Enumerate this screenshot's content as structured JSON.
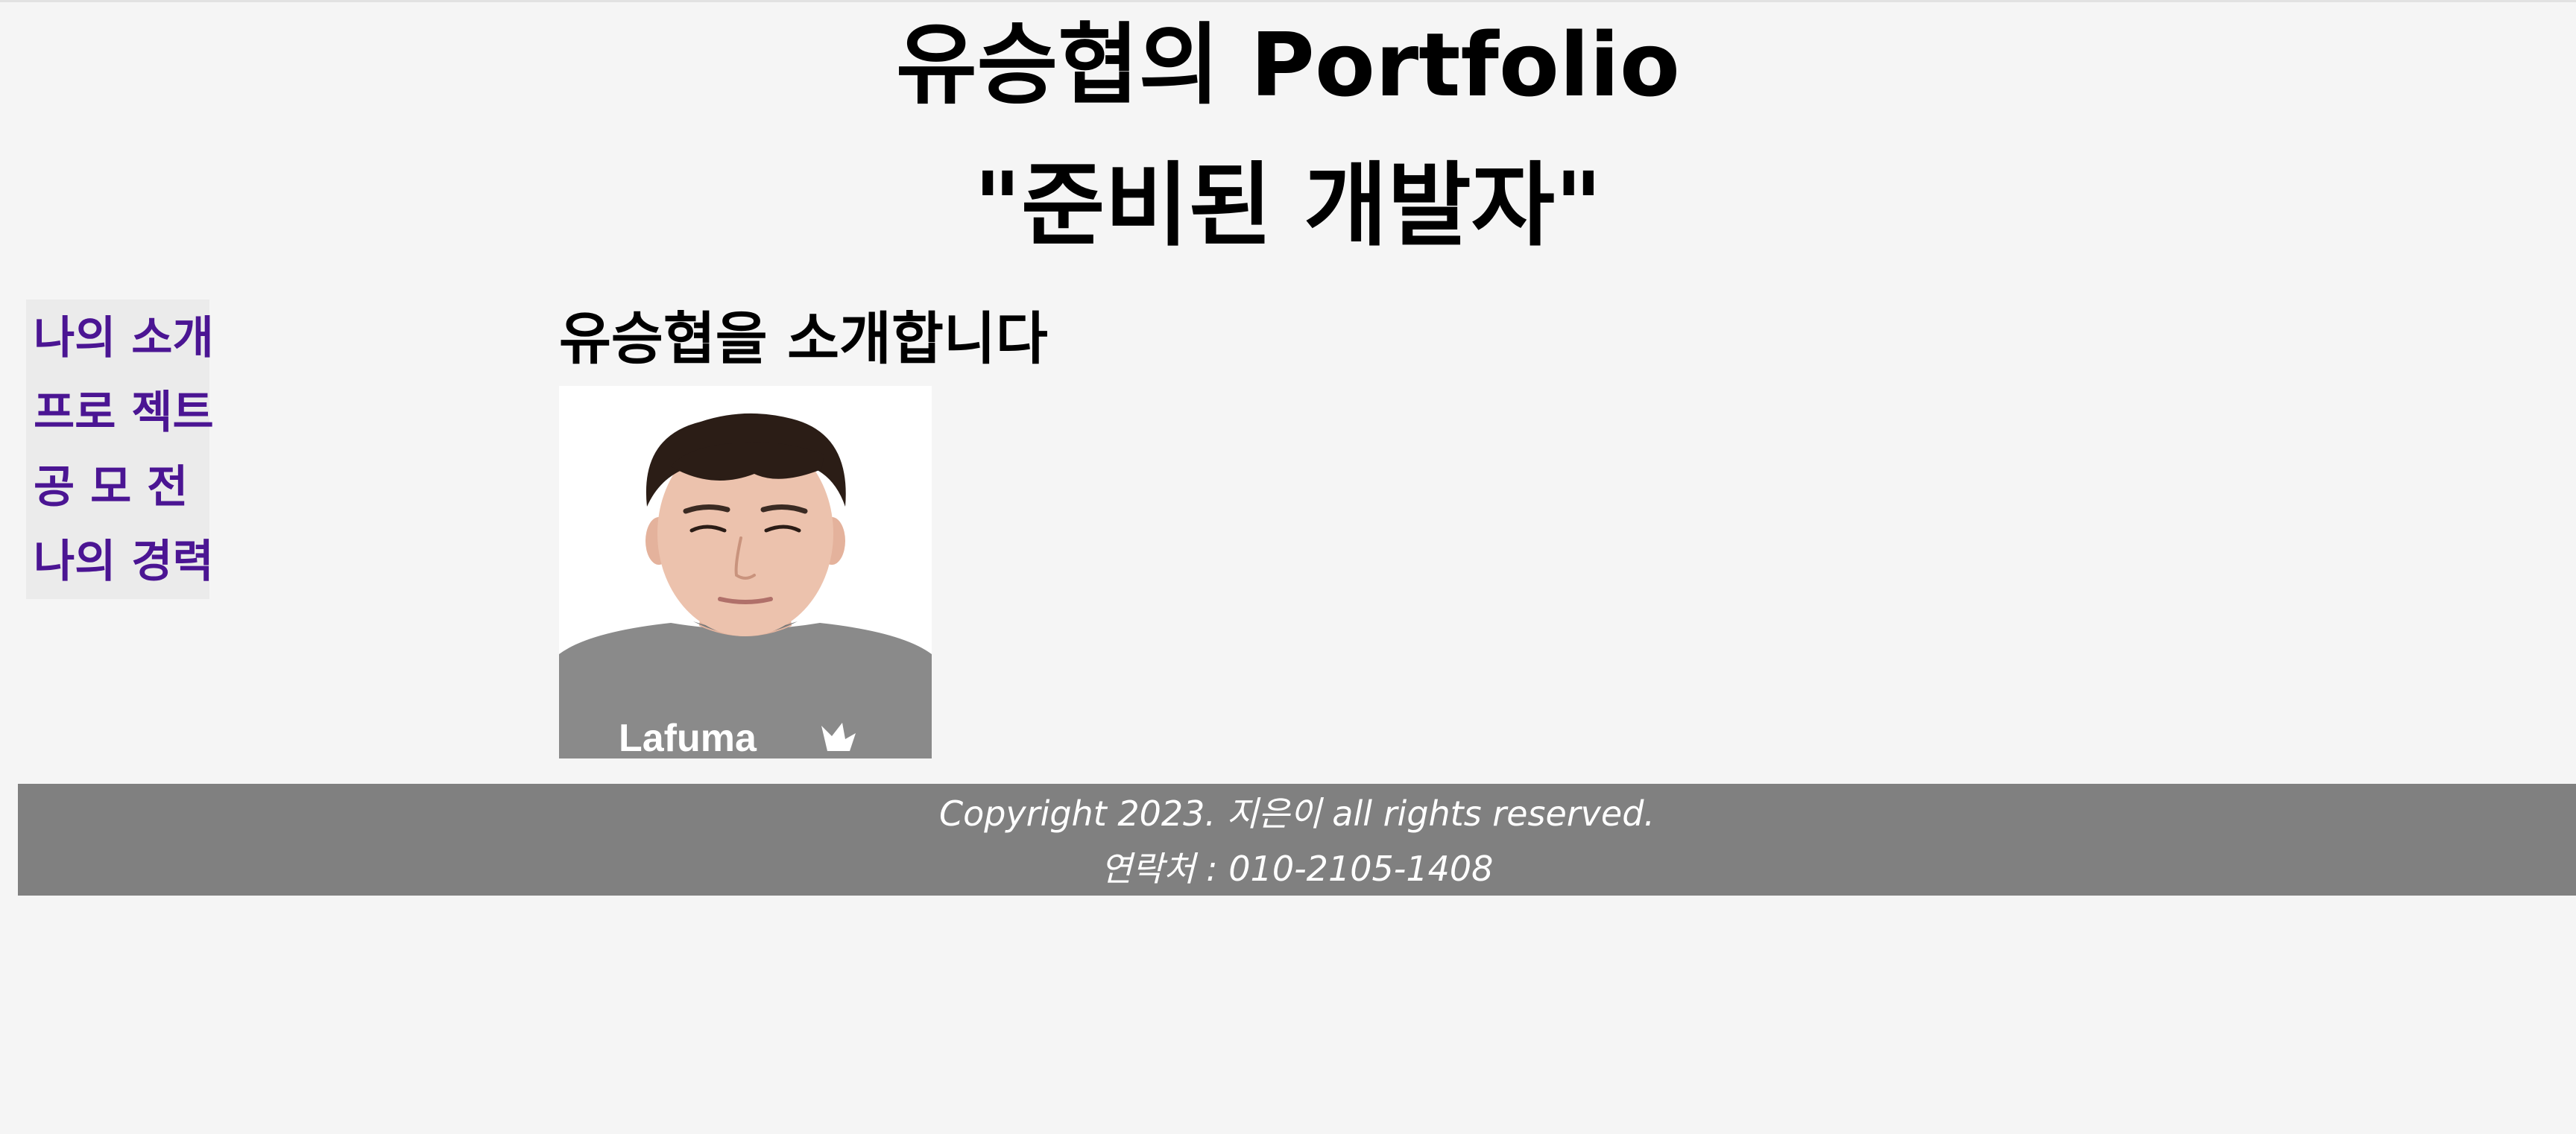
{
  "header": {
    "title": "유승협의 Portfolio",
    "slogan": "\"준비된 개발자\""
  },
  "nav": {
    "items": [
      {
        "label": "나의 소개"
      },
      {
        "label": "프로 젝트"
      },
      {
        "label": "공 모 전"
      },
      {
        "label": "나의 경력"
      }
    ]
  },
  "main": {
    "section_title": "유승협을 소개합니다",
    "photo": {
      "shirt_logo": "Lafuma",
      "shirt_color": "#8a8a8a",
      "hair_color": "#2b1d16",
      "skin_color": "#ecc2ad"
    }
  },
  "footer": {
    "copyright": "Copyright 2023. 지은이 all rights reserved.",
    "contact": "연락처 : 010-2105-1408",
    "background": "#808080"
  },
  "colors": {
    "page_background": "#f5f5f5",
    "nav_link": "#4b1593",
    "nav_background": "#ebebeb"
  }
}
